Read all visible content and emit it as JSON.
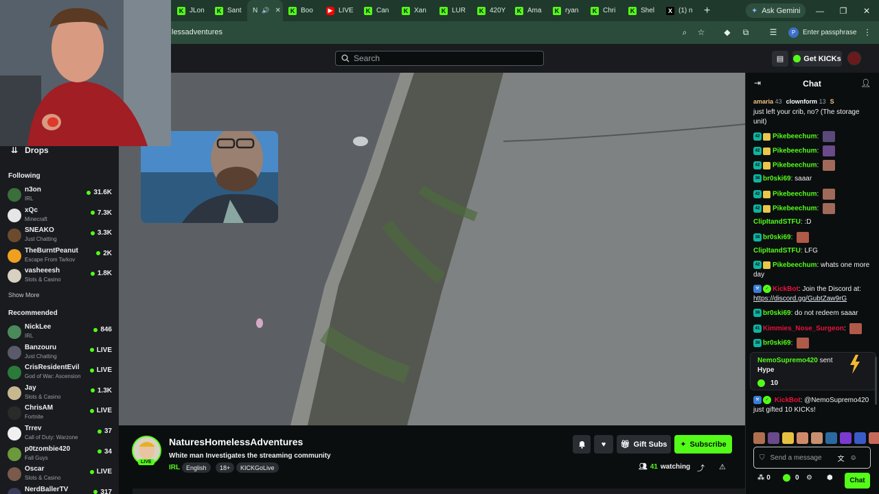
{
  "browser": {
    "tabs": [
      {
        "label": "JLon",
        "icon": "kick-favicon"
      },
      {
        "label": "Sant",
        "icon": "kick-favicon"
      },
      {
        "label": "N",
        "icon": "kick-favicon",
        "active": true
      },
      {
        "label": "Boo",
        "icon": "kick-favicon"
      },
      {
        "label": "LIVE",
        "icon": "youtube-favicon"
      },
      {
        "label": "Can",
        "icon": "kick-favicon"
      },
      {
        "label": "Xan",
        "icon": "kick-favicon"
      },
      {
        "label": "LUR",
        "icon": "kick-favicon"
      },
      {
        "label": "420Y",
        "icon": "kick-favicon"
      },
      {
        "label": "Ama",
        "icon": "kick-favicon"
      },
      {
        "label": "ryan",
        "icon": "kick-favicon"
      },
      {
        "label": "Chri",
        "icon": "kick-favicon"
      },
      {
        "label": "Shel",
        "icon": "kick-favicon"
      },
      {
        "label": "(1) n",
        "icon": "x-favicon"
      }
    ],
    "ask_gemini": "Ask Gemini",
    "url": "lessadventures",
    "passphrase": "Enter passphrase",
    "passphrase_avatar": "P"
  },
  "header": {
    "search_placeholder": "Search",
    "get_kicks": "Get KICKs"
  },
  "sidebar": {
    "drops": "Drops",
    "following_title": "Following",
    "following": [
      {
        "name": "n3on",
        "category": "IRL",
        "viewers": "31.6K",
        "color": "#3a6e3a"
      },
      {
        "name": "xQc",
        "category": "Minecraft",
        "viewers": "7.3K",
        "color": "#e6e6e6"
      },
      {
        "name": "SNEAKO",
        "category": "Just Chatting",
        "viewers": "3.3K",
        "color": "#6b4a2e"
      },
      {
        "name": "TheBurntPeanut",
        "category": "Escape From Tarkov",
        "viewers": "2K",
        "color": "#f0a020"
      },
      {
        "name": "vasheeesh",
        "category": "Slots & Casino",
        "viewers": "1.8K",
        "color": "#d8d0c0"
      }
    ],
    "show_more": "Show More",
    "recommended_title": "Recommended",
    "recommended": [
      {
        "name": "NickLee",
        "category": "IRL",
        "viewers": "846",
        "color": "#4a8a5a"
      },
      {
        "name": "Banzouru",
        "category": "Just Chatting",
        "viewers": "LIVE",
        "color": "#5a5a6a"
      },
      {
        "name": "CrisResidentEvil",
        "category": "God of War: Ascension",
        "viewers": "LIVE",
        "color": "#2a7a3a"
      },
      {
        "name": "Jay",
        "category": "Slots & Casino",
        "viewers": "1.3K",
        "color": "#c8b890"
      },
      {
        "name": "ChrisAM",
        "category": "Fortnite",
        "viewers": "LIVE",
        "color": "#2a2a2a"
      },
      {
        "name": "Trrev",
        "category": "Call of Duty: Warzone",
        "viewers": "37",
        "color": "#f0f0f0"
      },
      {
        "name": "p0tzombie420",
        "category": "Fall Guys",
        "viewers": "34",
        "color": "#6a9a3a"
      },
      {
        "name": "Oscar",
        "category": "Slots & Casino",
        "viewers": "LIVE",
        "color": "#7a5a4a"
      },
      {
        "name": "NerdBallerTV",
        "category": "",
        "viewers": "317",
        "color": "#3a3a5a"
      }
    ]
  },
  "stream": {
    "streamer": "NaturesHomelessAdventures",
    "title": "White man Investigates the streaming community",
    "live_badge": "LIVE",
    "category": "IRL",
    "tags": [
      "English",
      "18+",
      "KICKGoLive"
    ],
    "gift_subs": "Gift Subs",
    "subscribe": "Subscribe",
    "viewers": "41",
    "watching_label": "watching"
  },
  "chat": {
    "title": "Chat",
    "pinned": [
      {
        "user": "amaria",
        "count": "43"
      },
      {
        "user": "clownform",
        "count": "13"
      },
      {
        "user": "S",
        "count": ""
      }
    ],
    "messages": [
      {
        "user": "",
        "text": "just left your crib, no? (The storage unit)",
        "color": "#efeff1"
      },
      {
        "user": "Pikebeechum",
        "text": "",
        "color": "#53fc18",
        "badge": "42",
        "emote": "#5a4a7a"
      },
      {
        "user": "Pikebeechum",
        "text": "",
        "color": "#53fc18",
        "badge": "42",
        "emote": "#6a4a8a"
      },
      {
        "user": "Pikebeechum",
        "text": "",
        "color": "#53fc18",
        "badge": "42",
        "emote": "#a06a5a"
      },
      {
        "user": "br0ski69",
        "text": "saaar",
        "color": "#53fc18",
        "badge": "38"
      },
      {
        "user": "Pikebeechum",
        "text": "",
        "color": "#53fc18",
        "badge": "42",
        "emote": "#a06a5a"
      },
      {
        "user": "Pikebeechum",
        "text": "",
        "color": "#53fc18",
        "badge": "42",
        "emote": "#a06a5a"
      },
      {
        "user": "ClipItandSTFU",
        "text": ":D",
        "color": "#53fc18"
      },
      {
        "user": "br0ski69",
        "text": "",
        "color": "#53fc18",
        "badge": "38",
        "emote": "#b05a4a"
      },
      {
        "user": "ClipItandSTFU",
        "text": "LFG",
        "color": "#53fc18"
      },
      {
        "user": "Pikebeechum",
        "text": "whats one more day",
        "color": "#53fc18",
        "badge": "42"
      },
      {
        "user": "KickBot",
        "text": "Join the Discord at:",
        "link": "https://discord.gg/GubtZaw9rG",
        "color": "#e9113c"
      },
      {
        "user": "br0ski69",
        "text": "do not redeem saaar",
        "color": "#53fc18",
        "badge": "38"
      },
      {
        "user": "Kimmies_Nose_Surgeon",
        "text": "",
        "color": "#e9113c",
        "badge": "41",
        "emote": "#b05a4a"
      },
      {
        "user": "br0ski69",
        "text": "",
        "color": "#53fc18",
        "badge": "38",
        "emote": "#b05a4a"
      }
    ],
    "gift": {
      "user": "NemoSupremo420",
      "sent": "sent",
      "type": "Hype",
      "amount": "10"
    },
    "kickbot_gift": {
      "user": "KickBot",
      "text": "@NemoSupremo420 just gifted 10 KICKs!"
    },
    "input_placeholder": "Send a message",
    "kicks_count": "0",
    "points_count": "0",
    "chat_button": "Chat"
  }
}
